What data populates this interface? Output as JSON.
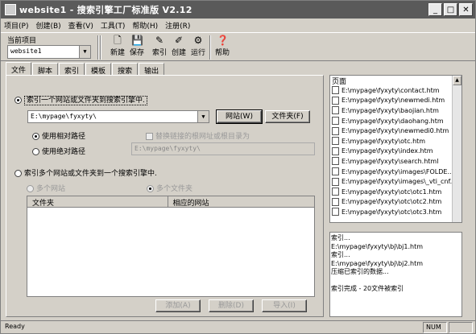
{
  "title": "website1 - 搜索引擎工厂标准版 V2.12",
  "menu": [
    "项目(P)",
    "创建(B)",
    "查看(V)",
    "工具(T)",
    "帮助(H)",
    "注册(R)"
  ],
  "project": {
    "label": "当前项目",
    "value": "website1"
  },
  "toolbar": {
    "new": "新建",
    "save": "保存",
    "index": "索引",
    "create": "创建",
    "run": "运行",
    "help": "帮助"
  },
  "tabs": [
    "文件",
    "脚本",
    "索引",
    "模板",
    "搜索",
    "输出"
  ],
  "file_tab": {
    "option_single": "索引一个网站或文件夹到搜索引擎中.",
    "path_value": "E:\\mypage\\fyxyty\\",
    "btn_site": "网站(W)",
    "btn_folder": "文件夹(F)",
    "relative": "使用相对路径",
    "absolute": "使用绝对路径",
    "replace_root": "替换链接的根网址或根目录为",
    "root_value": "E:\\mypage\\fyxyty\\",
    "option_multi": "索引多个网站或文件夹到一个搜索引擎中.",
    "multi_sites": "多个网站",
    "multi_folders": "多个文件夹",
    "col_folder": "文件夹",
    "col_site": "相应的网站",
    "btn_add": "添加(A)",
    "btn_delete": "删除(D)",
    "btn_import": "导入(I)"
  },
  "pages": {
    "header": "页面",
    "items": [
      "E:\\mypage\\fyxyty\\contact.htm",
      "E:\\mypage\\fyxyty\\newmedi.htm",
      "E:\\mypage\\fyxyty\\baojian.htm",
      "E:\\mypage\\fyxyty\\daohang.htm",
      "E:\\mypage\\fyxyty\\newmedi0.htm",
      "E:\\mypage\\fyxyty\\otc.htm",
      "E:\\mypage\\fyxyty\\index.htm",
      "E:\\mypage\\fyxyty\\search.html",
      "E:\\mypage\\fyxyty\\images\\FOLDE...",
      "E:\\mypage\\fyxyty\\images\\_vti_cnf...",
      "E:\\mypage\\fyxyty\\otc\\otc1.htm",
      "E:\\mypage\\fyxyty\\otc\\otc2.htm",
      "E:\\mypage\\fyxyty\\otc\\otc3.htm"
    ]
  },
  "log": [
    "索引...",
    "E:\\mypage\\fyxyty\\bj\\bj1.htm",
    "索引...",
    "E:\\mypage\\fyxyty\\bj\\bj2.htm",
    "压缩已索引的数据...",
    "",
    "索引完成 - 20文件被索引"
  ],
  "status": {
    "ready": "Ready",
    "num": "NUM"
  }
}
